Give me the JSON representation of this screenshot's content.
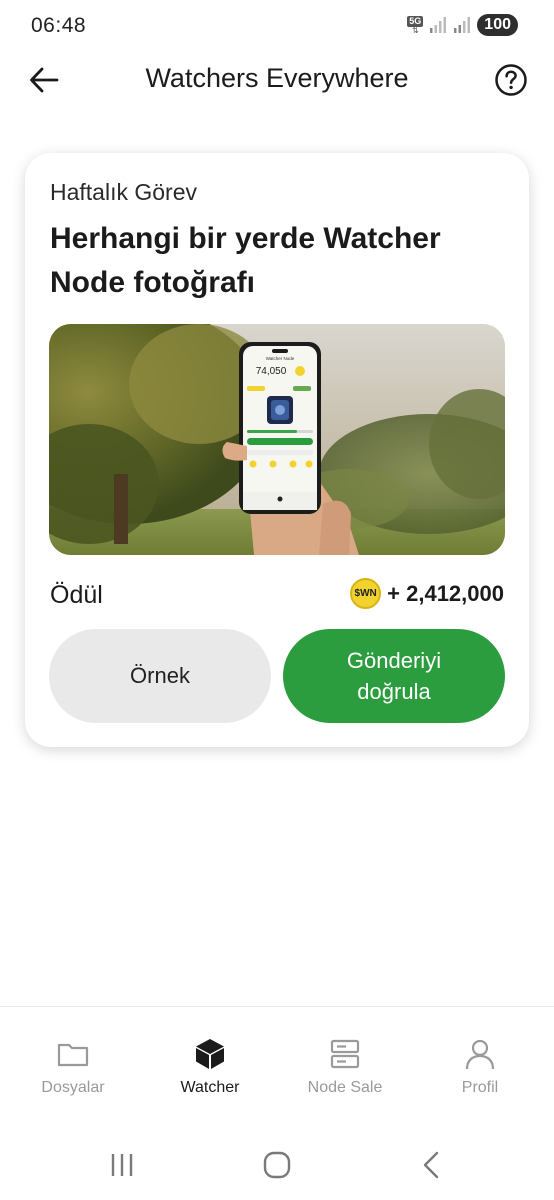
{
  "status_bar": {
    "time": "06:48",
    "network": "5G",
    "battery": "100"
  },
  "header": {
    "title": "Watchers Everywhere",
    "back_icon": "arrow-left-icon",
    "help_icon": "question-circle-icon"
  },
  "card": {
    "subtitle": "Haftalık Görev",
    "title": "Herhangi bir yerde Watcher Node fotoğrafı",
    "image": {
      "phone_title": "Watcher Node",
      "phone_balance": "74,050"
    },
    "reward_label": "Ödül",
    "reward_token": "$WN",
    "reward_amount": "+ 2,412,000",
    "example_button": "Örnek",
    "verify_button": "Gönderiyi doğrula"
  },
  "bottom_nav": {
    "items": [
      {
        "label": "Dosyalar",
        "icon": "folder-icon",
        "active": false
      },
      {
        "label": "Watcher",
        "icon": "cube-icon",
        "active": true
      },
      {
        "label": "Node Sale",
        "icon": "server-icon",
        "active": false
      },
      {
        "label": "Profil",
        "icon": "user-icon",
        "active": false
      }
    ]
  },
  "colors": {
    "accent_green": "#2b9d3e",
    "coin_yellow": "#f2d22e",
    "button_gray": "#e9e9e9"
  }
}
